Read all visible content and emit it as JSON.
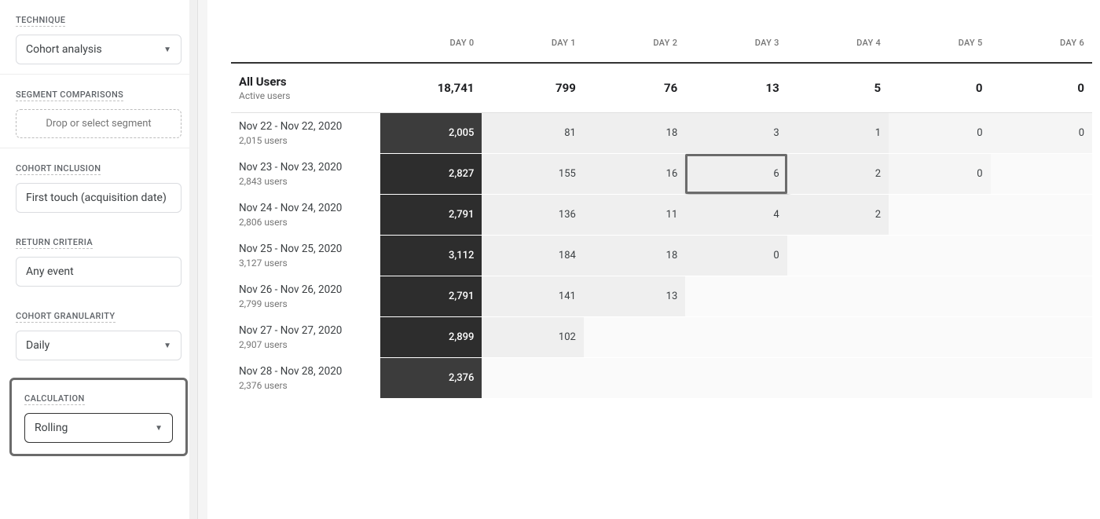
{
  "sidebar": {
    "technique": {
      "label": "TECHNIQUE",
      "value": "Cohort analysis"
    },
    "segment": {
      "label": "SEGMENT COMPARISONS",
      "placeholder": "Drop or select segment"
    },
    "inclusion": {
      "label": "COHORT INCLUSION",
      "value": "First touch (acquisition date)"
    },
    "return": {
      "label": "RETURN CRITERIA",
      "value": "Any event"
    },
    "granularity": {
      "label": "COHORT GRANULARITY",
      "value": "Daily"
    },
    "calculation": {
      "label": "CALCULATION",
      "value": "Rolling"
    }
  },
  "table": {
    "headers": [
      "",
      "DAY 0",
      "DAY 1",
      "DAY 2",
      "DAY 3",
      "DAY 4",
      "DAY 5",
      "DAY 6"
    ],
    "summary": {
      "title": "All Users",
      "subtitle": "Active users",
      "values": [
        "18,741",
        "799",
        "76",
        "13",
        "5",
        "0",
        "0"
      ]
    },
    "rows": [
      {
        "range": "Nov 22 - Nov 22, 2020",
        "users": "2,015 users",
        "cells": [
          "2,005",
          "81",
          "18",
          "3",
          "1",
          "0",
          "0"
        ],
        "shades": [
          "dark",
          "light",
          "light",
          "light",
          "light",
          "vlight",
          "vlight"
        ]
      },
      {
        "range": "Nov 23 - Nov 23, 2020",
        "users": "2,843 users",
        "cells": [
          "2,827",
          "155",
          "16",
          "6",
          "2",
          "0",
          ""
        ],
        "shades": [
          "darker",
          "light",
          "light",
          "light",
          "light",
          "vlight",
          "blank"
        ],
        "highlightIndex": 3
      },
      {
        "range": "Nov 24 - Nov 24, 2020",
        "users": "2,806 users",
        "cells": [
          "2,791",
          "136",
          "11",
          "4",
          "2",
          "",
          ""
        ],
        "shades": [
          "darker",
          "light",
          "light",
          "light",
          "light",
          "blank",
          "blank"
        ]
      },
      {
        "range": "Nov 25 - Nov 25, 2020",
        "users": "3,127 users",
        "cells": [
          "3,112",
          "184",
          "18",
          "0",
          "",
          "",
          ""
        ],
        "shades": [
          "darker",
          "light",
          "light",
          "light",
          "blank",
          "blank",
          "blank"
        ]
      },
      {
        "range": "Nov 26 - Nov 26, 2020",
        "users": "2,799 users",
        "cells": [
          "2,791",
          "141",
          "13",
          "",
          "",
          "",
          ""
        ],
        "shades": [
          "darker",
          "light",
          "light",
          "blank",
          "blank",
          "blank",
          "blank"
        ]
      },
      {
        "range": "Nov 27 - Nov 27, 2020",
        "users": "2,907 users",
        "cells": [
          "2,899",
          "102",
          "",
          "",
          "",
          "",
          ""
        ],
        "shades": [
          "darker",
          "light",
          "blank",
          "blank",
          "blank",
          "blank",
          "blank"
        ]
      },
      {
        "range": "Nov 28 - Nov 28, 2020",
        "users": "2,376 users",
        "cells": [
          "2,376",
          "",
          "",
          "",
          "",
          "",
          ""
        ],
        "shades": [
          "dark",
          "blank",
          "blank",
          "blank",
          "blank",
          "blank",
          "blank"
        ]
      }
    ]
  },
  "chart_data": {
    "type": "table",
    "title": "Cohort analysis – Rolling",
    "columns": [
      "DAY 0",
      "DAY 1",
      "DAY 2",
      "DAY 3",
      "DAY 4",
      "DAY 5",
      "DAY 6"
    ],
    "row_labels": [
      "All Users",
      "Nov 22 - Nov 22, 2020",
      "Nov 23 - Nov 23, 2020",
      "Nov 24 - Nov 24, 2020",
      "Nov 25 - Nov 25, 2020",
      "Nov 26 - Nov 26, 2020",
      "Nov 27 - Nov 27, 2020",
      "Nov 28 - Nov 28, 2020"
    ],
    "values": [
      [
        18741,
        799,
        76,
        13,
        5,
        0,
        0
      ],
      [
        2005,
        81,
        18,
        3,
        1,
        0,
        0
      ],
      [
        2827,
        155,
        16,
        6,
        2,
        0,
        null
      ],
      [
        2791,
        136,
        11,
        4,
        2,
        null,
        null
      ],
      [
        3112,
        184,
        18,
        0,
        null,
        null,
        null
      ],
      [
        2791,
        141,
        13,
        null,
        null,
        null,
        null
      ],
      [
        2899,
        102,
        null,
        null,
        null,
        null,
        null
      ],
      [
        2376,
        null,
        null,
        null,
        null,
        null,
        null
      ]
    ]
  }
}
